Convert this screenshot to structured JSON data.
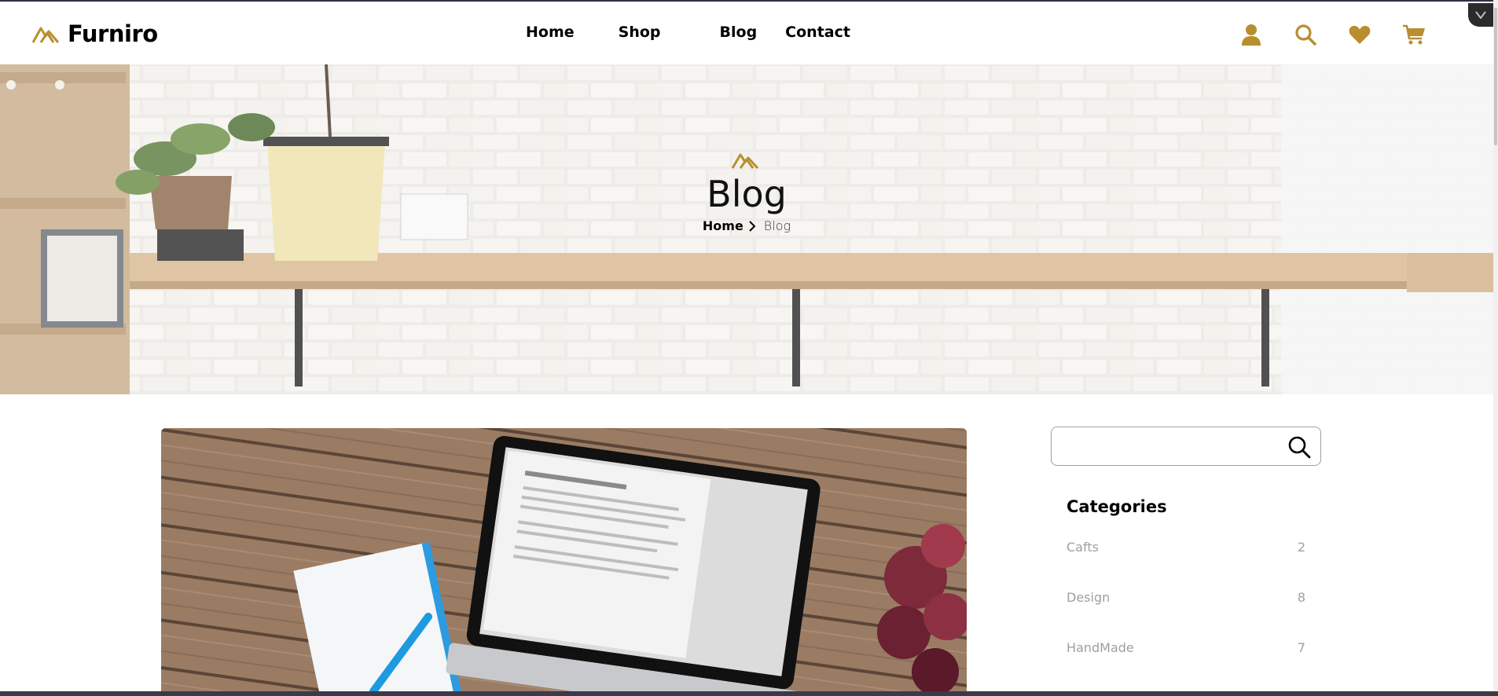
{
  "brand": {
    "name": "Furniro",
    "accent": "#B88E2F"
  },
  "nav": {
    "items": [
      {
        "label": "Home"
      },
      {
        "label": "Shop"
      },
      {
        "label": "Blog"
      },
      {
        "label": "Contact"
      }
    ]
  },
  "header_icons": [
    "user-icon",
    "search-icon",
    "heart-icon",
    "cart-icon"
  ],
  "hero": {
    "title": "Blog",
    "breadcrumb": {
      "home": "Home",
      "current": "Blog"
    }
  },
  "sidebar": {
    "search": {
      "value": "",
      "placeholder": ""
    },
    "categories_heading": "Categories",
    "categories": [
      {
        "name": "Cafts",
        "count": "2"
      },
      {
        "name": "Design",
        "count": "8"
      },
      {
        "name": "HandMade",
        "count": "7"
      }
    ]
  }
}
